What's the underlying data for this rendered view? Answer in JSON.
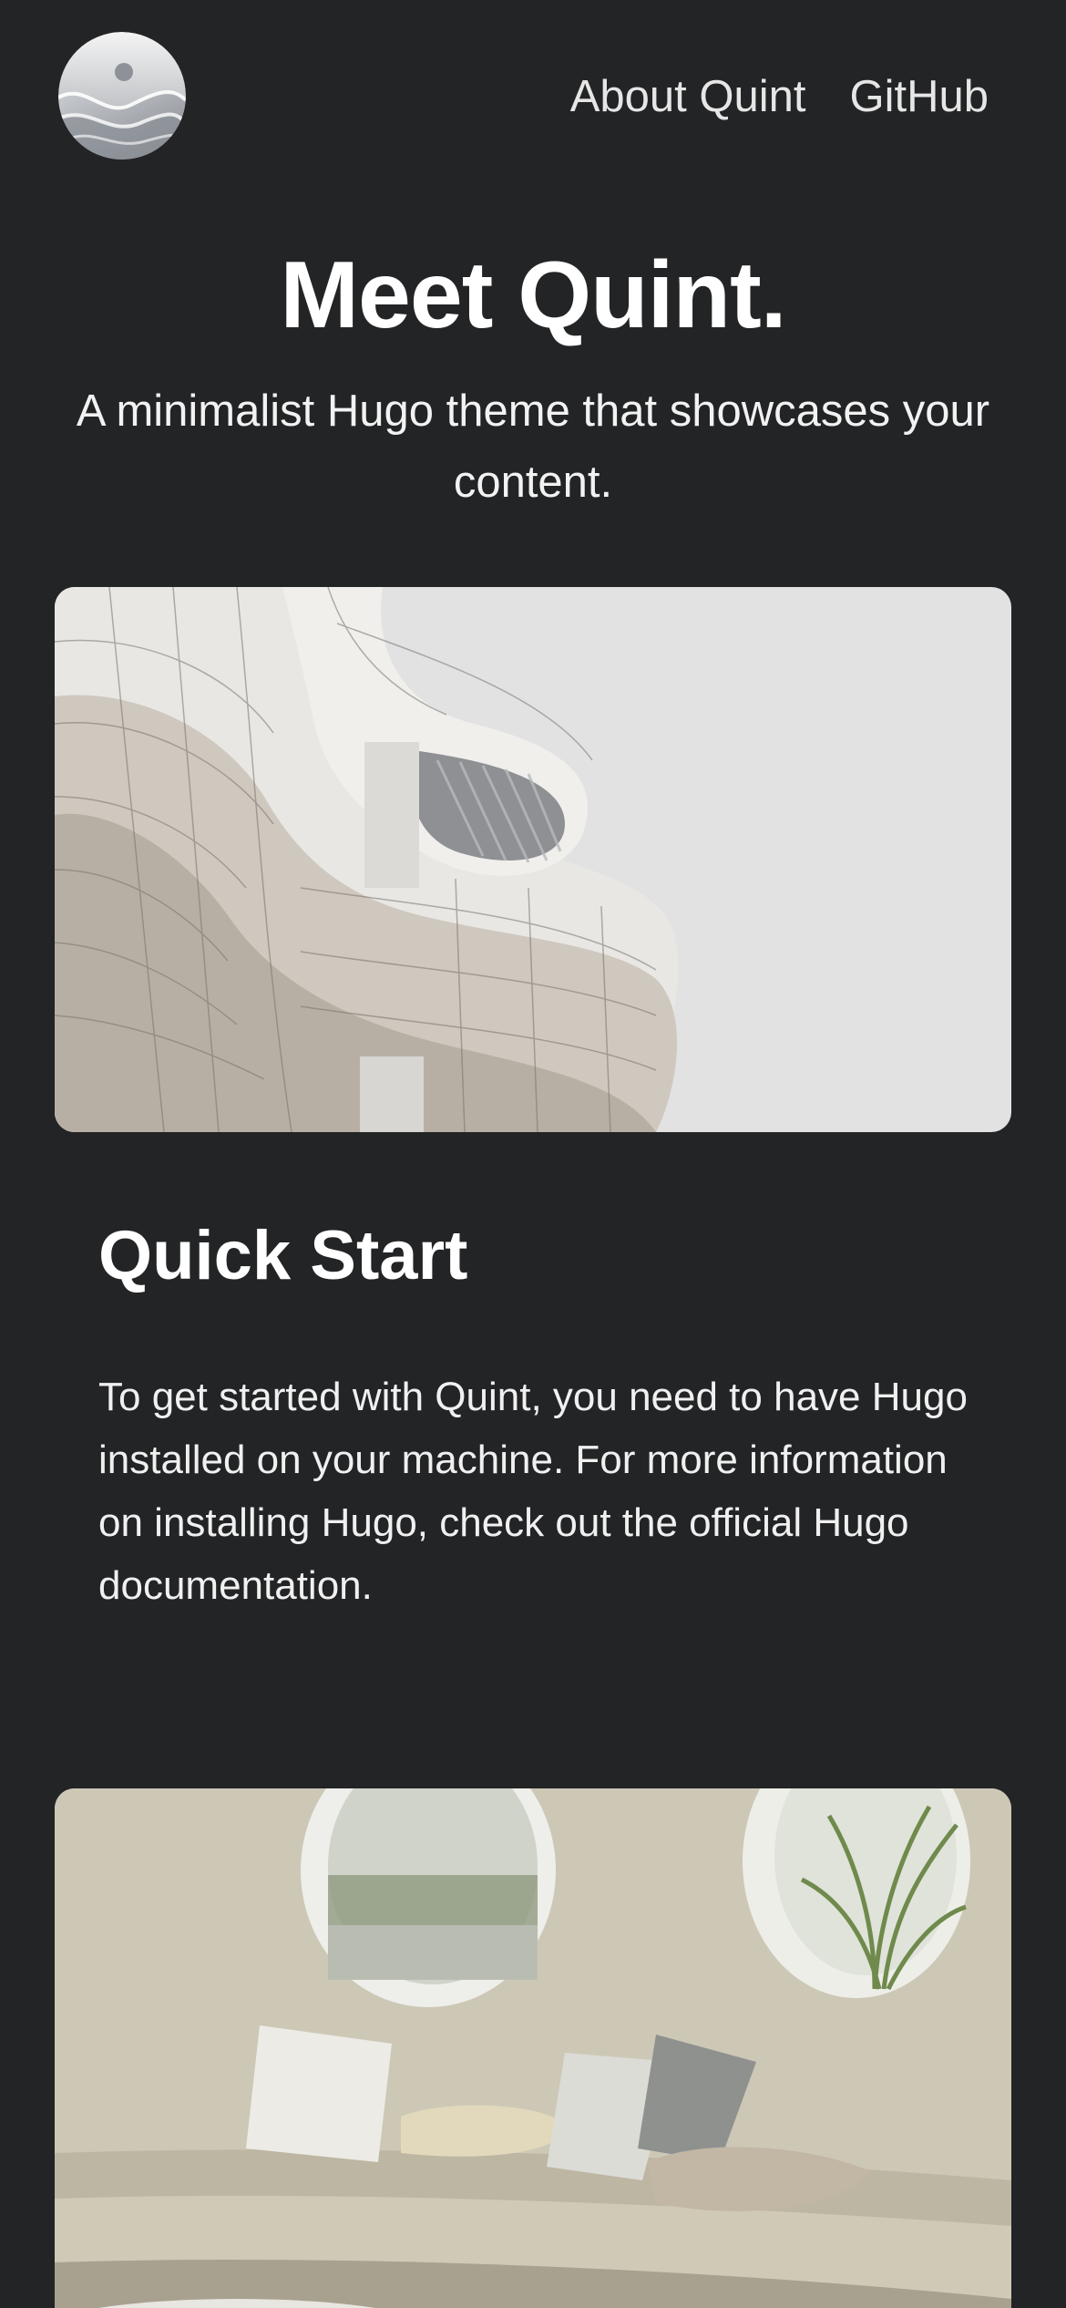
{
  "header": {
    "logo_icon": "yin-yang-wave-logo-icon",
    "nav": [
      {
        "label": "About Quint"
      },
      {
        "label": "GitHub"
      }
    ]
  },
  "hero": {
    "title": "Meet Quint.",
    "subtitle": "A minimalist Hugo theme that showcases your content."
  },
  "cards": [
    {
      "image": "white curved modern architecture photo",
      "title": "Quick Start",
      "body": "To get started with Quint, you need to have Hugo installed on your machine. For more information on installing Hugo, check out the official Hugo documentation."
    },
    {
      "image": "beige curved sofa with pillows and oval windows photo"
    }
  ],
  "colors": {
    "background": "#232426",
    "text": "#ffffff",
    "nav_text": "#e6e6e6"
  }
}
